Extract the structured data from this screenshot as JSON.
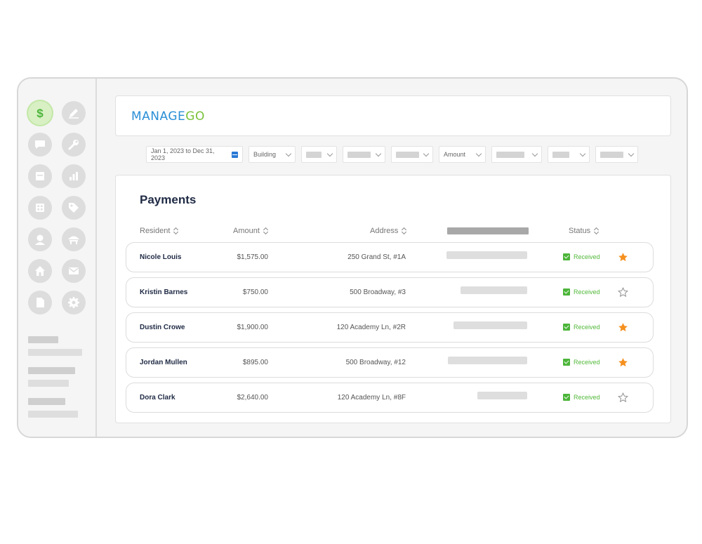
{
  "app": {
    "logo_part1": "MANAGE",
    "logo_part2": "GO",
    "brand_colors": {
      "blue": "#2a8fd6",
      "green": "#79c23a",
      "accent_star": "#f5901e"
    }
  },
  "sidebar": {
    "icons": [
      {
        "name": "dollar-icon",
        "active": true
      },
      {
        "name": "pen-icon"
      },
      {
        "name": "chat-icon"
      },
      {
        "name": "wrench-icon"
      },
      {
        "name": "calendar-icon"
      },
      {
        "name": "bar-chart-icon"
      },
      {
        "name": "building-icon"
      },
      {
        "name": "tag-icon"
      },
      {
        "name": "person-icon"
      },
      {
        "name": "umbrella-icon"
      },
      {
        "name": "home-icon"
      },
      {
        "name": "mail-icon"
      },
      {
        "name": "document-icon"
      },
      {
        "name": "gear-icon"
      }
    ]
  },
  "filters": {
    "date_range": "Jan 1, 2023 to Dec 31, 2023",
    "building": "Building",
    "amount": "Amount"
  },
  "payments": {
    "title": "Payments",
    "columns": {
      "resident": "Resident",
      "amount": "Amount",
      "address": "Address",
      "status": "Status"
    },
    "rows": [
      {
        "resident": "Nicole Louis",
        "amount": "$1,575.00",
        "address": "250 Grand St, #1A",
        "status": "Received",
        "starred": true
      },
      {
        "resident": "Kristin Barnes",
        "amount": "$750.00",
        "address": "500 Broadway, #3",
        "status": "Received",
        "starred": false
      },
      {
        "resident": "Dustin Crowe",
        "amount": "$1,900.00",
        "address": "120 Academy Ln, #2R",
        "status": "Received",
        "starred": true
      },
      {
        "resident": "Jordan Mullen",
        "amount": "$895.00",
        "address": "500 Broadway, #12",
        "status": "Received",
        "starred": true
      },
      {
        "resident": "Dora Clark",
        "amount": "$2,640.00",
        "address": "120 Academy Ln, #8F",
        "status": "Received",
        "starred": false
      }
    ]
  }
}
